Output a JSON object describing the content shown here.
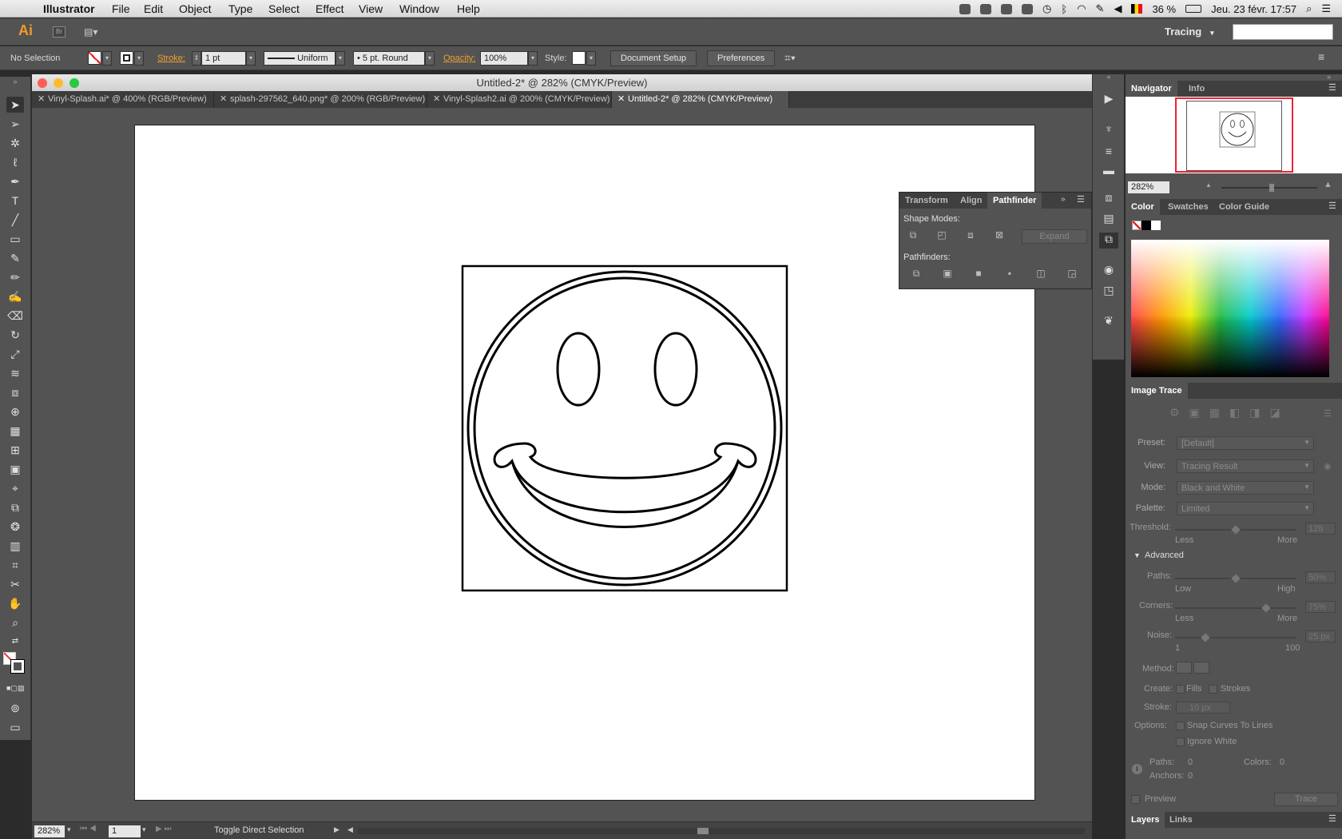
{
  "menubar": {
    "app": "Illustrator",
    "items": [
      "File",
      "Edit",
      "Object",
      "Type",
      "Select",
      "Effect",
      "View",
      "Window",
      "Help"
    ],
    "battery": "36 %",
    "datetime": "Jeu. 23 févr.  17:57"
  },
  "appbar": {
    "logo": "Ai",
    "bridge": "Br",
    "workspace": "Tracing",
    "workspace_arrow": "▾"
  },
  "control": {
    "selection": "No Selection",
    "stroke_label": "Stroke:",
    "stroke_weight": "1 pt",
    "profile": "Uniform",
    "brush": "5 pt. Round",
    "opacity_label": "Opacity:",
    "opacity": "100%",
    "style_label": "Style:",
    "doc_setup": "Document Setup",
    "preferences": "Preferences"
  },
  "window": {
    "title": "Untitled-2* @ 282% (CMYK/Preview)"
  },
  "tabs": [
    {
      "label": "Vinyl-Splash.ai* @ 400% (RGB/Preview)",
      "active": false
    },
    {
      "label": "splash-297562_640.png* @ 200% (RGB/Preview)",
      "active": false
    },
    {
      "label": "Vinyl-Splash2.ai @ 200% (CMYK/Preview)",
      "active": false
    },
    {
      "label": "Untitled-2* @ 282% (CMYK/Preview)",
      "active": true
    }
  ],
  "status": {
    "zoom": "282%",
    "page": "1",
    "message": "Toggle Direct Selection"
  },
  "pathfinder": {
    "tabs": [
      "Transform",
      "Align",
      "Pathfinder"
    ],
    "shape_modes": "Shape Modes:",
    "pathfinders": "Pathfinders:",
    "expand": "Expand"
  },
  "navigator": {
    "tabs": [
      "Navigator",
      "Info"
    ],
    "zoom": "282%"
  },
  "color": {
    "tabs": [
      "Color",
      "Swatches",
      "Color Guide"
    ]
  },
  "image_trace": {
    "title": "Image Trace",
    "preset": {
      "label": "Preset:",
      "value": "[Default]"
    },
    "view": {
      "label": "View:",
      "value": "Tracing Result"
    },
    "mode": {
      "label": "Mode:",
      "value": "Black and White"
    },
    "palette": {
      "label": "Palette:",
      "value": "Limited"
    },
    "threshold": {
      "label": "Threshold:",
      "value": "128",
      "min": "Less",
      "max": "More",
      "level": 0.5
    },
    "advanced": "Advanced",
    "paths": {
      "label": "Paths:",
      "value": "50%",
      "min": "Low",
      "max": "High",
      "level": 0.5
    },
    "corners": {
      "label": "Corners:",
      "value": "75%",
      "min": "Less",
      "max": "More",
      "level": 0.75
    },
    "noise": {
      "label": "Noise:",
      "value": "25 px",
      "min": "1",
      "max": "100",
      "level": 0.25
    },
    "method": "Method:",
    "create": {
      "label": "Create:",
      "fills": "Fills",
      "strokes": "Strokes"
    },
    "stroke": {
      "label": "Stroke:",
      "value": "10 px"
    },
    "options": {
      "label": "Options:",
      "snap": "Snap Curves To Lines",
      "ignore": "Ignore White"
    },
    "info": {
      "paths": "Paths:",
      "paths_val": "0",
      "colors": "Colors:",
      "colors_val": "0",
      "anchors": "Anchors:",
      "anchors_val": "0"
    },
    "preview": "Preview",
    "trace": "Trace"
  },
  "layers": {
    "tabs": [
      "Layers",
      "Links"
    ]
  }
}
